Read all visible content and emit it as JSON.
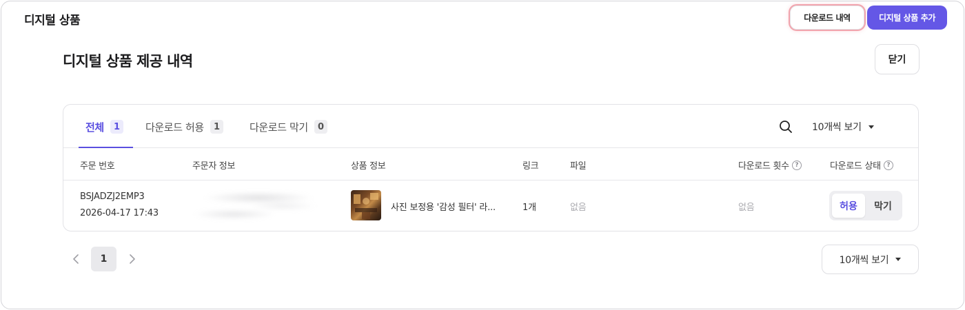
{
  "header": {
    "app_title": "디지털 상품",
    "download_history_label": "다운로드 내역",
    "add_product_label": "디지털 상품 추가"
  },
  "section": {
    "title": "디지털 상품 제공 내역",
    "close_label": "닫기"
  },
  "tabs": [
    {
      "label": "전체",
      "count": "1",
      "active": true
    },
    {
      "label": "다운로드 허용",
      "count": "1",
      "active": false
    },
    {
      "label": "다운로드 막기",
      "count": "0",
      "active": false
    }
  ],
  "toolbar": {
    "search_icon": "search-icon",
    "page_size_label": "10개씩 보기"
  },
  "table": {
    "columns": [
      "주문 번호",
      "주문자 정보",
      "상품 정보",
      "링크",
      "파일",
      "다운로드 횟수",
      "다운로드 상태"
    ],
    "rows": [
      {
        "order_no": "BSJADZJ2EMP3",
        "order_date": "2026-04-17 17:43",
        "product_name": "사진 보정용 '감성 필터' 라...",
        "link": "1개",
        "file": "없음",
        "download_count": "없음",
        "status_allow": "허용",
        "status_block": "막기",
        "status_selected": "허용"
      }
    ]
  },
  "pagination": {
    "current_page": "1",
    "page_size_label": "10개씩 보기"
  },
  "colors": {
    "accent": "#5a4fe0",
    "primary_button": "#6457e6",
    "highlight_ring": "#f2a4ad"
  }
}
